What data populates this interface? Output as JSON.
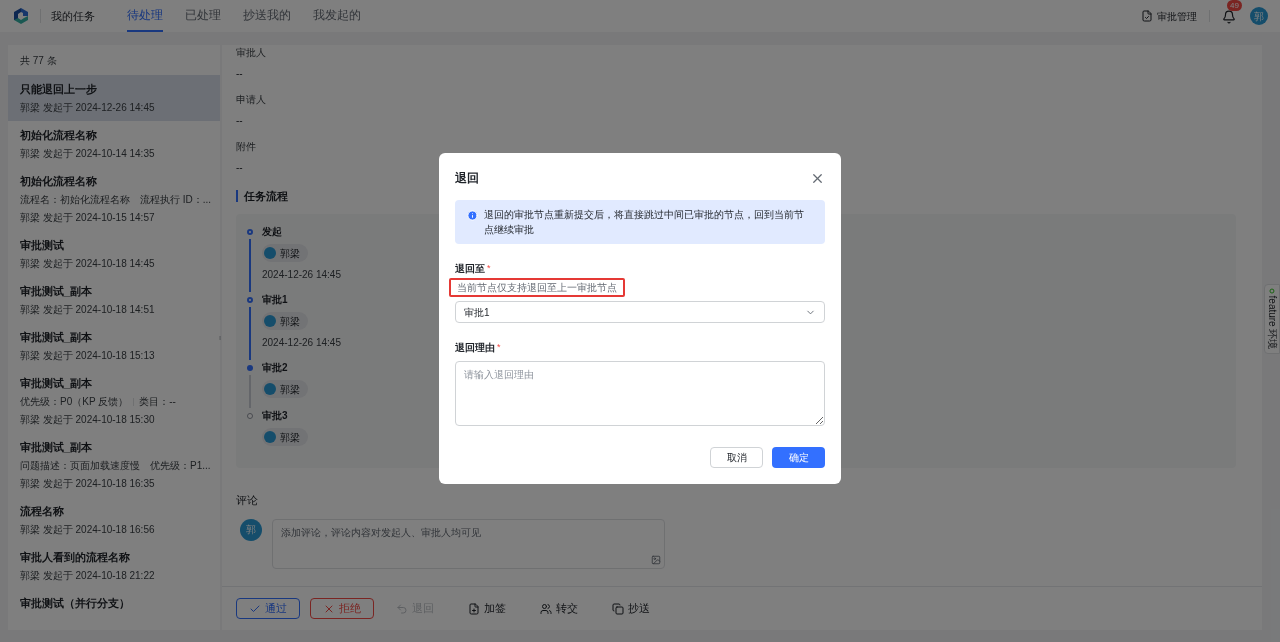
{
  "header": {
    "title": "我的任务",
    "tabs": [
      {
        "label": "待处理",
        "selected": true
      },
      {
        "label": "已处理",
        "selected": false
      },
      {
        "label": "抄送我的",
        "selected": false
      },
      {
        "label": "我发起的",
        "selected": false
      }
    ],
    "admin_link": "审批管理",
    "notification_count": "49",
    "avatar": "郭"
  },
  "task_list": {
    "count": "共 77 条",
    "items": [
      {
        "title": "只能退回上一步",
        "subtitle": "郭梁 发起于 2024-12-26 14:45",
        "selected": true
      },
      {
        "title": "初始化流程名称",
        "subtitle": "郭梁 发起于 2024-10-14 14:35",
        "selected": false
      },
      {
        "title": "初始化流程名称",
        "meta": [
          "流程名：初始化流程名称",
          "流程执行 ID：..."
        ],
        "subtitle": "郭梁 发起于 2024-10-15 14:57",
        "selected": false
      },
      {
        "title": "审批测试",
        "subtitle": "郭梁 发起于 2024-10-18 14:45",
        "selected": false
      },
      {
        "title": "审批测试_副本",
        "subtitle": "郭梁 发起于 2024-10-18 14:51",
        "selected": false
      },
      {
        "title": "审批测试_副本",
        "subtitle": "郭梁 发起于 2024-10-18 15:13",
        "selected": false
      },
      {
        "title": "审批测试_副本",
        "meta": [
          "优先级：P0（KP 反馈）",
          "类目：--"
        ],
        "subtitle": "郭梁 发起于 2024-10-18 15:30",
        "selected": false
      },
      {
        "title": "审批测试_副本",
        "meta": [
          "问题描述：页面加载速度慢",
          "优先级：P1..."
        ],
        "subtitle": "郭梁 发起于 2024-10-18 16:35",
        "selected": false
      },
      {
        "title": "流程名称",
        "subtitle": "郭梁 发起于 2024-10-18 16:56",
        "selected": false
      },
      {
        "title": "审批人看到的流程名称",
        "subtitle": "郭梁 发起于 2024-10-18 21:22",
        "selected": false
      },
      {
        "title": "审批测试（并行分支）",
        "selected": false
      }
    ]
  },
  "detail": {
    "fields": [
      {
        "label": "审批人",
        "value": "--"
      },
      {
        "label": "申请人",
        "value": "--"
      },
      {
        "label": "附件",
        "value": "--"
      }
    ],
    "flow_title": "任务流程",
    "flow_nodes": [
      {
        "name": "发起",
        "kind": "done",
        "people": [
          "郭梁"
        ],
        "time": "2024-12-26 14:45"
      },
      {
        "name": "审批1",
        "kind": "done",
        "people": [
          "郭梁"
        ],
        "time": "2024-12-26 14:45"
      },
      {
        "name": "审批2",
        "kind": "current",
        "people": [
          "郭梁"
        ]
      },
      {
        "name": "审批3",
        "kind": "pending",
        "people": [
          "郭梁"
        ]
      }
    ],
    "comment_title": "评论",
    "comment_avatar": "郭",
    "comment_placeholder": "添加评论，评论内容对发起人、审批人均可见"
  },
  "actions": [
    {
      "label": "通过",
      "kind": "approve",
      "disabled": false
    },
    {
      "label": "拒绝",
      "kind": "reject",
      "disabled": false
    },
    {
      "label": "退回",
      "kind": "return",
      "disabled": true
    },
    {
      "label": "加签",
      "kind": "add",
      "disabled": false
    },
    {
      "label": "转交",
      "kind": "transfer",
      "disabled": false
    },
    {
      "label": "抄送",
      "kind": "cc",
      "disabled": false
    }
  ],
  "env_tab": "feature 环境",
  "dialog": {
    "title": "退回",
    "notice": "退回的审批节点重新提交后，将直接跳过中间已审批的节点，回到当前节点继续审批",
    "target": {
      "label": "退回至",
      "required_mark": "*",
      "hint": "当前节点仅支持退回至上一审批节点",
      "hint_highlighted": true,
      "value": "审批1"
    },
    "reason": {
      "label": "退回理由",
      "required_mark": "*",
      "placeholder": "请输入退回理由"
    },
    "buttons": [
      {
        "label": "取消",
        "kind": "secondary"
      },
      {
        "label": "确定",
        "kind": "primary"
      }
    ]
  }
}
